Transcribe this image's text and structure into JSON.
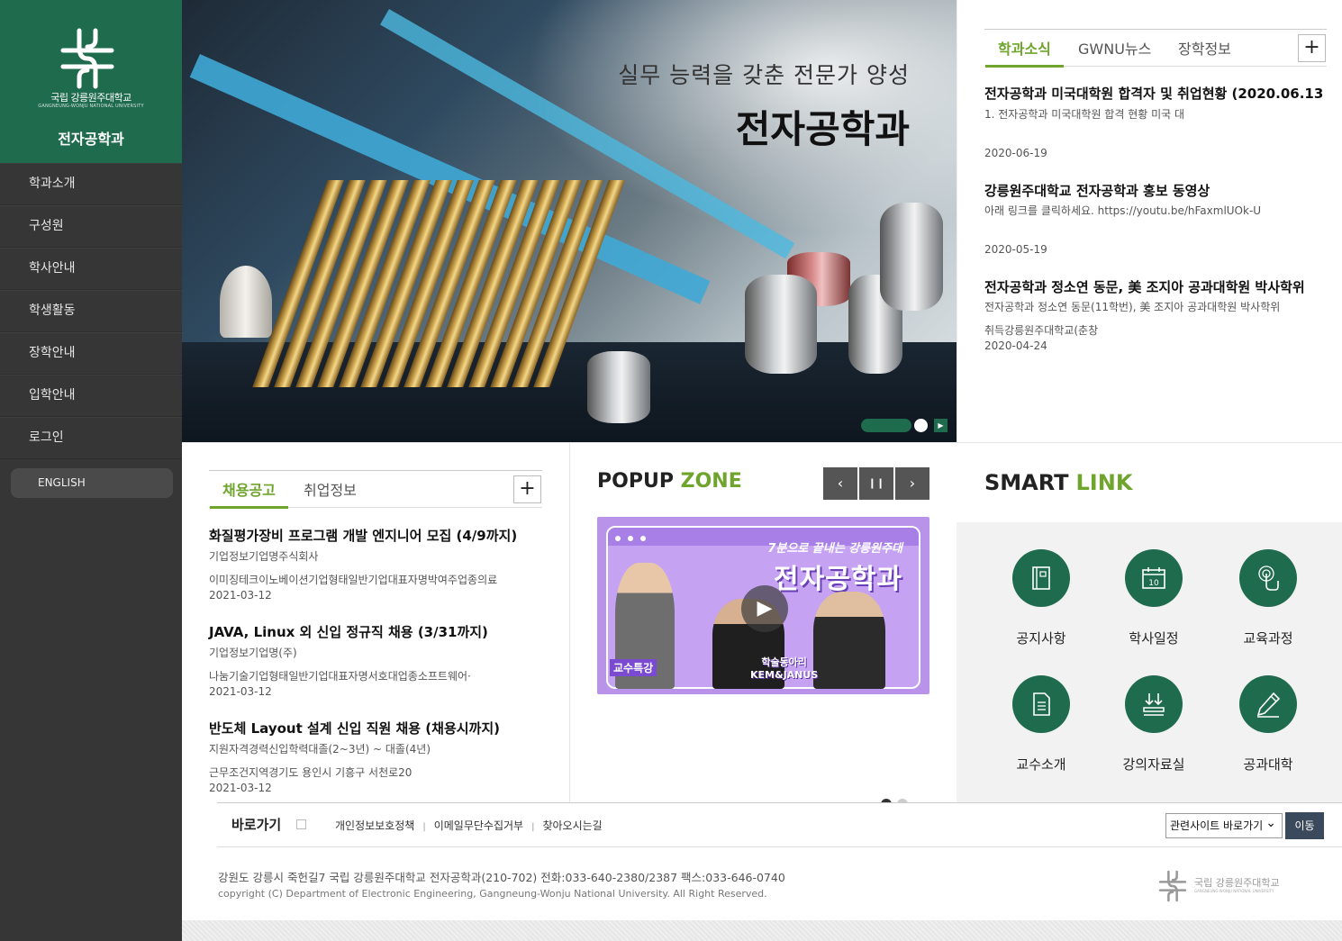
{
  "sidebar": {
    "university": "국립 강릉원주대학교",
    "university_en": "GANGNEUNG-WONJU NATIONAL UNIVERSITY",
    "department": "전자공학과",
    "menu": [
      "학과소개",
      "구성원",
      "학사안내",
      "학생활동",
      "장학안내",
      "입학안내",
      "로그인"
    ],
    "english": "ENGLISH"
  },
  "hero": {
    "subtitle": "실무 능력을 갖춘 전문가 양성",
    "title": "전자공학과",
    "play_icon": "play-icon"
  },
  "news": {
    "tabs": [
      "학과소식",
      "GWNU뉴스",
      "장학정보"
    ],
    "items": [
      {
        "title": "전자공학과 미국대학원 합격자 및 취업현황 (2020.06.13",
        "desc": "1. 전자공학과 미국대학원 합격 현황 미국 대",
        "date": "2020-06-19"
      },
      {
        "title": "강릉원주대학교 전자공학과 홍보 동영상",
        "desc": "아래 링크를 클릭하세요. https://youtu.be/hFaxmlUOk-U",
        "date": "2020-05-19"
      },
      {
        "title": "전자공학과 정소연 동문, 美 조지아 공과대학원 박사학위",
        "desc": "전자공학과 정소연 동문(11학번), 美 조지아 공과대학원 박사학위",
        "desc2": "취득강릉원주대학교(춘창",
        "date": "2020-04-24"
      }
    ]
  },
  "jobs": {
    "tabs": [
      "채용공고",
      "취업정보"
    ],
    "items": [
      {
        "title": "화질평가장비 프로그램 개발 엔지니어 모집 (4/9까지)",
        "company": "기업정보기업명주식회사",
        "detail": "이미징테크이노베이션기업형태일반기업대표자명박여주업종의료",
        "date": "2021-03-12"
      },
      {
        "title": "JAVA, Linux 외 신입 정규직 채용 (3/31까지)",
        "company": "기업정보기업명(주)",
        "detail": "나눔기술기업형태일반기업대표자명서호대업종소프트웨어·",
        "date": "2021-03-12"
      },
      {
        "title": "반도체 Layout 설계 신입 직원 채용 (채용시까지)",
        "company": "지원자격경력신입학력대졸(2~3년) ~ 대졸(4년)",
        "detail": "근무조건지역경기도 용인시 기흥구 서천로20",
        "date": "2021-03-12"
      }
    ]
  },
  "popup": {
    "title_a": "POPUP",
    "title_b": "ZONE",
    "prev": "‹",
    "pause": "❙❙",
    "next": "›",
    "banner_top": "7분으로 끝내는 강릉원주대",
    "banner_main": "전자공학과",
    "banner_label1": "교수특강",
    "banner_label2a": "학술동아리",
    "banner_label2b": "KEM&JANUS"
  },
  "smart": {
    "title_a": "SMART",
    "title_b": "LINK",
    "links": [
      {
        "label": "공지사항",
        "icon": "notebook-icon"
      },
      {
        "label": "학사일정",
        "icon": "calendar-icon"
      },
      {
        "label": "교육과정",
        "icon": "touch-icon"
      },
      {
        "label": "교수소개",
        "icon": "document-icon"
      },
      {
        "label": "강의자료실",
        "icon": "download-icon"
      },
      {
        "label": "공과대학",
        "icon": "pen-icon"
      }
    ]
  },
  "footer": {
    "shortcut": "바로가기",
    "links": [
      "개인정보보호정책",
      "이메일무단수집거부",
      "찾아오시는길"
    ],
    "select": "관련사이트 바로가기",
    "go": "이동",
    "address": "강원도 강릉시 죽헌길7 국립 강릉원주대학교 전자공학과(210-702) 전화:033-640-2380/2387 팩스:033-646-0740",
    "copyright": "copyright (C) Department of Electronic Engineering, Gangneung-Wonju National University. All Right Reserved.",
    "logo_text": "국립 강릉원주대학교",
    "logo_text_en": "GANGNEUNG-WONJU NATIONAL UNIVERSITY"
  },
  "colors": {
    "brand_green": "#1f6b4e",
    "accent_green": "#6fa42d",
    "sidebar_dark": "#363636"
  }
}
